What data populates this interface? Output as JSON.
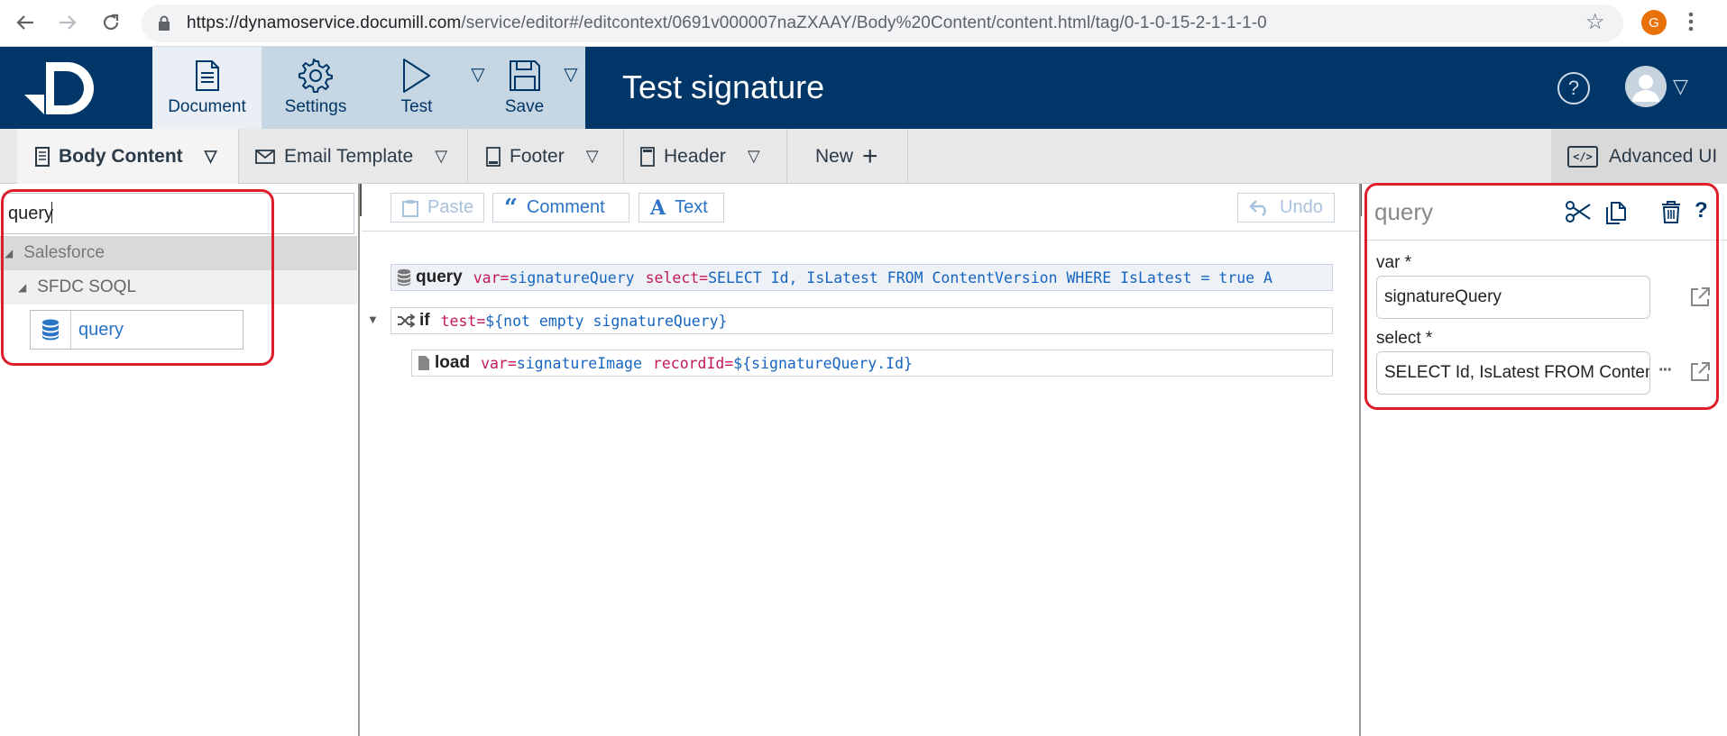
{
  "browser": {
    "url_host": "https://dynamoservice.documill.com",
    "url_path": "/service/editor#/editcontext/0691v000007naZXAAY/Body%20Content/content.html/tag/0-1-0-15-2-1-1-1-0",
    "profile_initial": "G"
  },
  "ribbon": {
    "document_label": "Document",
    "settings_label": "Settings",
    "test_label": "Test",
    "save_label": "Save",
    "dropdown_glyph": "▽"
  },
  "app": {
    "title": "Test signature",
    "help_glyph": "?"
  },
  "tabs": [
    {
      "label": "Body Content",
      "icon": "document-icon"
    },
    {
      "label": "Email Template",
      "icon": "envelope-icon"
    },
    {
      "label": "Footer",
      "icon": "footer-icon"
    },
    {
      "label": "Header",
      "icon": "header-icon"
    },
    {
      "label": "New",
      "icon": "plus-icon"
    }
  ],
  "tab_caret": "▽",
  "advanced_ui": {
    "label": "Advanced UI",
    "icon_text": "</>"
  },
  "left": {
    "search_value": "query",
    "tree": {
      "group": "Salesforce",
      "subgroup": "SFDC SOQL",
      "item": "query"
    }
  },
  "toolbar": {
    "paste": "Paste",
    "comment": "Comment",
    "text": "Text",
    "undo": "Undo"
  },
  "code": {
    "query": {
      "keyword": "query",
      "attr1": "var=",
      "val1": "signatureQuery",
      "attr2": "select=",
      "val2": "SELECT Id, IsLatest FROM ContentVersion WHERE IsLatest = true A"
    },
    "if": {
      "keyword": "if",
      "attr1": "test=",
      "val1": "${not empty signatureQuery}"
    },
    "load": {
      "keyword": "load",
      "attr1": "var=",
      "val1": "signatureImage",
      "attr2": "recordId=",
      "val2": "${signatureQuery.Id}"
    }
  },
  "right": {
    "title": "query",
    "var_label": "var *",
    "var_value": "signatureQuery",
    "select_label": "select *",
    "select_value": "SELECT Id, IsLatest FROM ContentVersion",
    "more_glyph": "···"
  },
  "colors": {
    "header_bg": "#003768",
    "ribbon_bg": "#c7d6e3",
    "highlight": "#e01d2a",
    "link_blue": "#2a73c6",
    "attr_pink": "#c2185b"
  }
}
